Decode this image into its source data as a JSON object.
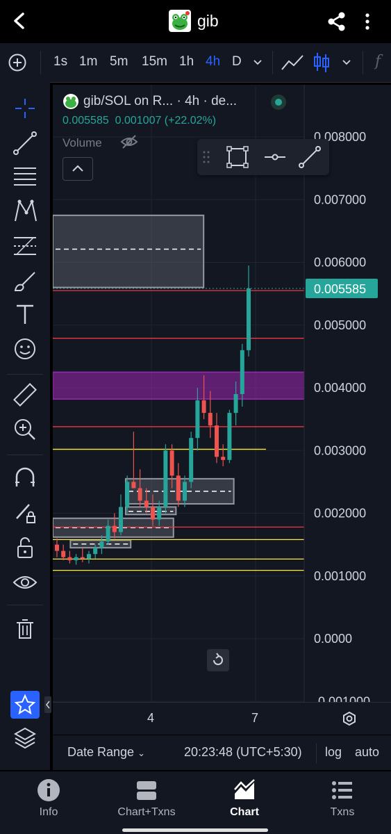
{
  "header": {
    "title": "gib",
    "back_icon": "back-arrow-icon",
    "share_icon": "share-icon",
    "menu_icon": "more-vertical-icon"
  },
  "toolbar": {
    "timeframes": [
      "1s",
      "1m",
      "5m",
      "15m",
      "1h",
      "4h",
      "D"
    ],
    "active_timeframe": "4h"
  },
  "legend": {
    "symbol": "gib/SOL on R... · 4h · de...",
    "price": "0.005585",
    "change": "0.001007 (+22.02%)",
    "volume_label": "Volume"
  },
  "chart": {
    "price_labels": [
      "0.008000",
      "0.007000",
      "0.006000",
      "0.005000",
      "0.004000",
      "0.003000",
      "0.002000",
      "0.001000",
      "0.0000",
      "-0.001000"
    ],
    "last_price": "0.005585",
    "x_labels": [
      "4",
      "7"
    ],
    "colors": {
      "up": "#26a69a",
      "down": "#ef5350",
      "zone": "#9c27b0",
      "hline_red": "#f23645",
      "hline_yellow": "#ffeb3b"
    }
  },
  "chart_data": {
    "type": "candlestick",
    "ylim": [
      -0.001,
      0.0085
    ],
    "x_ticks": [
      "4",
      "7"
    ],
    "last_price": 0.005585,
    "candles": [
      {
        "o": 0.0015,
        "h": 0.0016,
        "l": 0.0013,
        "c": 0.0014
      },
      {
        "o": 0.0014,
        "h": 0.0015,
        "l": 0.00125,
        "c": 0.0013
      },
      {
        "o": 0.0013,
        "h": 0.0014,
        "l": 0.0012,
        "c": 0.00125
      },
      {
        "o": 0.00125,
        "h": 0.00135,
        "l": 0.00118,
        "c": 0.0013
      },
      {
        "o": 0.0013,
        "h": 0.00145,
        "l": 0.00122,
        "c": 0.00128
      },
      {
        "o": 0.00128,
        "h": 0.0014,
        "l": 0.0012,
        "c": 0.00135
      },
      {
        "o": 0.00135,
        "h": 0.0015,
        "l": 0.00128,
        "c": 0.00145
      },
      {
        "o": 0.00145,
        "h": 0.00165,
        "l": 0.00135,
        "c": 0.00155
      },
      {
        "o": 0.00155,
        "h": 0.0019,
        "l": 0.0015,
        "c": 0.0018
      },
      {
        "o": 0.0018,
        "h": 0.002,
        "l": 0.0016,
        "c": 0.0017
      },
      {
        "o": 0.0017,
        "h": 0.0023,
        "l": 0.00165,
        "c": 0.0021
      },
      {
        "o": 0.0021,
        "h": 0.0026,
        "l": 0.002,
        "c": 0.0025
      },
      {
        "o": 0.0025,
        "h": 0.0033,
        "l": 0.0024,
        "c": 0.0024
      },
      {
        "o": 0.0024,
        "h": 0.0027,
        "l": 0.0021,
        "c": 0.0022
      },
      {
        "o": 0.0022,
        "h": 0.0024,
        "l": 0.002,
        "c": 0.0021
      },
      {
        "o": 0.0021,
        "h": 0.0023,
        "l": 0.0018,
        "c": 0.0019
      },
      {
        "o": 0.0019,
        "h": 0.0022,
        "l": 0.0018,
        "c": 0.0021
      },
      {
        "o": 0.0021,
        "h": 0.0031,
        "l": 0.002,
        "c": 0.003
      },
      {
        "o": 0.003,
        "h": 0.0031,
        "l": 0.0024,
        "c": 0.0026
      },
      {
        "o": 0.0026,
        "h": 0.0028,
        "l": 0.0021,
        "c": 0.0022
      },
      {
        "o": 0.0022,
        "h": 0.0026,
        "l": 0.0021,
        "c": 0.0025
      },
      {
        "o": 0.0025,
        "h": 0.0033,
        "l": 0.0024,
        "c": 0.0032
      },
      {
        "o": 0.0032,
        "h": 0.004,
        "l": 0.003,
        "c": 0.0038
      },
      {
        "o": 0.0038,
        "h": 0.0042,
        "l": 0.0035,
        "c": 0.0036
      },
      {
        "o": 0.0036,
        "h": 0.00395,
        "l": 0.0032,
        "c": 0.0034
      },
      {
        "o": 0.0034,
        "h": 0.0036,
        "l": 0.0028,
        "c": 0.0029
      },
      {
        "o": 0.0029,
        "h": 0.0031,
        "l": 0.00275,
        "c": 0.00285
      },
      {
        "o": 0.00285,
        "h": 0.00365,
        "l": 0.0028,
        "c": 0.0036
      },
      {
        "o": 0.0036,
        "h": 0.0041,
        "l": 0.0034,
        "c": 0.0039
      },
      {
        "o": 0.0039,
        "h": 0.0047,
        "l": 0.0037,
        "c": 0.0046
      },
      {
        "o": 0.0046,
        "h": 0.00595,
        "l": 0.0045,
        "c": 0.005585
      }
    ],
    "horizontal_lines": [
      {
        "price": 0.00555,
        "color": "red"
      },
      {
        "price": 0.00479,
        "color": "red"
      },
      {
        "price": 0.00338,
        "color": "red"
      },
      {
        "price": 0.00302,
        "color": "yellow"
      },
      {
        "price": 0.00178,
        "color": "red"
      },
      {
        "price": 0.00158,
        "color": "yellow"
      },
      {
        "price": 0.00127,
        "color": "yellow"
      },
      {
        "price": 0.00109,
        "color": "yellow"
      }
    ],
    "zones": [
      {
        "from": 0.00382,
        "to": 0.00425,
        "color": "purple"
      }
    ],
    "boxes": [
      {
        "x0": 0,
        "x1": 0.6,
        "top": 0.00675,
        "bottom": 0.0056,
        "mid": 0.00621
      },
      {
        "x0": 0.29,
        "x1": 0.72,
        "top": 0.00255,
        "bottom": 0.00215,
        "mid": 0.00235
      },
      {
        "x0": 0.29,
        "x1": 0.49,
        "top": 0.0021,
        "bottom": 0.00198,
        "mid": 0.00203
      },
      {
        "x0": 0,
        "x1": 0.48,
        "top": 0.00192,
        "bottom": 0.00162,
        "mid": 0.00177
      },
      {
        "x0": 0.07,
        "x1": 0.31,
        "top": 0.00157,
        "bottom": 0.00145,
        "mid": 0.00151
      }
    ]
  },
  "bottom_bar": {
    "date_range": "Date Range",
    "time": "20:23:48 (UTC+5:30)",
    "log": "log",
    "auto": "auto"
  },
  "nav": [
    {
      "label": "Info",
      "icon": "info-icon"
    },
    {
      "label": "Chart+Txns",
      "icon": "split-view-icon"
    },
    {
      "label": "Chart",
      "icon": "chart-icon"
    },
    {
      "label": "Txns",
      "icon": "list-icon"
    }
  ],
  "active_nav": "Chart"
}
